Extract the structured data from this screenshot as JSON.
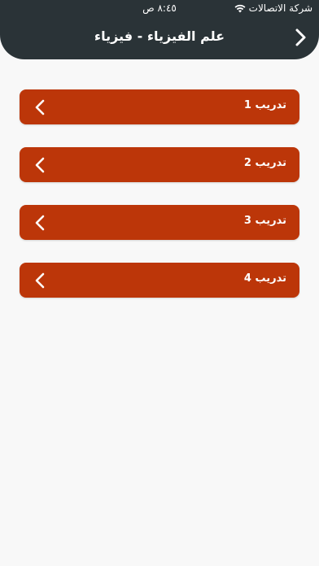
{
  "status_bar": {
    "carrier": "شركة الاتصالات",
    "time": "٨:٤٥ ص"
  },
  "header": {
    "title": "علم الفيزياء  - فيزياء",
    "back_icon": "chevron-right-icon"
  },
  "colors": {
    "header_bg": "#2a3337",
    "item_bg": "#bc3609",
    "page_bg": "#f8f8f8"
  },
  "items": [
    {
      "label": "تدريب 1",
      "icon": "chevron-left-icon"
    },
    {
      "label": "تدريب 2",
      "icon": "chevron-left-icon"
    },
    {
      "label": "تدريب 3",
      "icon": "chevron-left-icon"
    },
    {
      "label": "تدريب 4",
      "icon": "chevron-left-icon"
    }
  ]
}
